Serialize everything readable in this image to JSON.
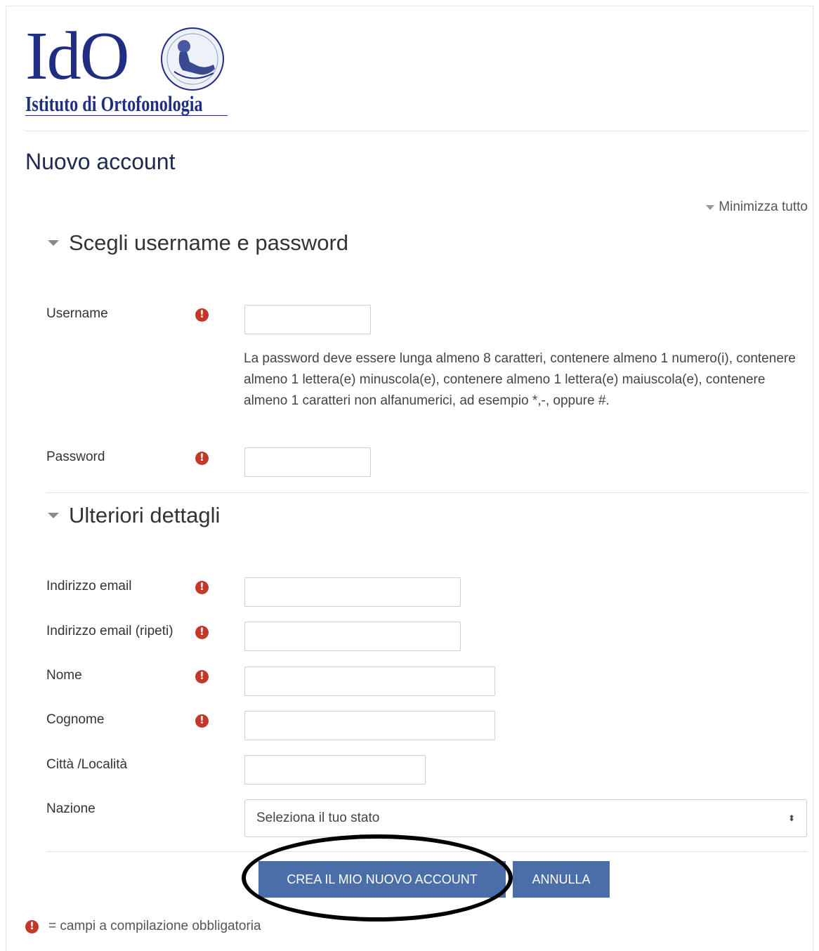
{
  "logo": {
    "main": "IdO",
    "subtitle": "Istituto di Ortofonologia"
  },
  "page_title": "Nuovo account",
  "collapse_all": "Minimizza tutto",
  "sections": {
    "credentials": {
      "title": "Scegli username e password"
    },
    "details": {
      "title": "Ulteriori dettagli"
    }
  },
  "fields": {
    "username": {
      "label": "Username",
      "value": ""
    },
    "password_help": "La password deve essere lunga almeno 8 caratteri, contenere almeno 1 numero(i), contenere almeno 1 lettera(e) minuscola(e), contenere almeno 1 lettera(e) maiuscola(e), contenere almeno 1 caratteri non alfanumerici, ad esempio *,-, oppure #.",
    "password": {
      "label": "Password",
      "value": ""
    },
    "email": {
      "label": "Indirizzo email",
      "value": ""
    },
    "email_repeat": {
      "label": "Indirizzo email (ripeti)",
      "value": ""
    },
    "first_name": {
      "label": "Nome",
      "value": ""
    },
    "last_name": {
      "label": "Cognome",
      "value": ""
    },
    "city": {
      "label": "Città /Località",
      "value": ""
    },
    "country": {
      "label": "Nazione",
      "selected": "Seleziona il tuo stato"
    }
  },
  "required_glyph": "!",
  "buttons": {
    "submit": "CREA IL MIO NUOVO ACCOUNT",
    "cancel": "ANNULLA"
  },
  "legend": "= campi a compilazione obbligatoria",
  "colors": {
    "brand": "#1f2e82",
    "button": "#4a6ea8",
    "required": "#c0392b"
  }
}
